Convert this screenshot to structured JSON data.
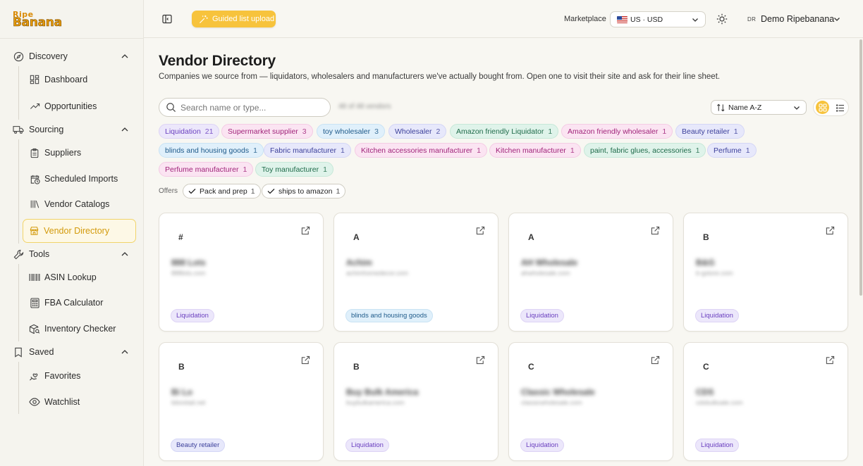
{
  "brand": {
    "logo_top": "Ripe",
    "logo_bottom": "Banana"
  },
  "sidebar": {
    "groups": [
      {
        "label": "Discovery",
        "items": [
          {
            "label": "Dashboard"
          },
          {
            "label": "Opportunities"
          }
        ]
      },
      {
        "label": "Sourcing",
        "items": [
          {
            "label": "Suppliers"
          },
          {
            "label": "Scheduled Imports"
          },
          {
            "label": "Vendor Catalogs"
          },
          {
            "label": "Vendor Directory",
            "active": true
          }
        ]
      },
      {
        "label": "Tools",
        "items": [
          {
            "label": "ASIN Lookup"
          },
          {
            "label": "FBA Calculator"
          },
          {
            "label": "Inventory Checker"
          }
        ]
      },
      {
        "label": "Saved",
        "items": [
          {
            "label": "Favorites"
          },
          {
            "label": "Watchlist"
          }
        ]
      }
    ]
  },
  "header": {
    "guided_label": "Guided list upload",
    "marketplace_label": "Marketplace",
    "marketplace_value": "US · USD",
    "user_initials": "DR",
    "user_name": "Demo Ripebanana"
  },
  "main": {
    "title": "Vendor Directory",
    "subtitle": "Companies we source from — liquidators, wholesalers and manufacturers we've actually bought from. Open one to visit their site and ask for their line sheet.",
    "search_placeholder": "Search name or type...",
    "count_text": "48 of 48 vendors",
    "sort_value": "Name A-Z",
    "chips": [
      {
        "label": "Liquidation",
        "count": "21",
        "color": "purple"
      },
      {
        "label": "Supermarket supplier",
        "count": "3",
        "color": "pink"
      },
      {
        "label": "toy wholesaler",
        "count": "3",
        "color": "blue"
      },
      {
        "label": "Wholesaler",
        "count": "2",
        "color": "indigo"
      },
      {
        "label": "Amazon friendly Liquidator",
        "count": "1",
        "color": "green"
      },
      {
        "label": "Amazon friendly wholesaler",
        "count": "1",
        "color": "pink"
      },
      {
        "label": "Beauty retailer",
        "count": "1",
        "color": "indigo"
      },
      {
        "label": "blinds and housing goods",
        "count": "1",
        "color": "blue"
      },
      {
        "label": "Fabric manufacturer",
        "count": "1",
        "color": "indigo"
      },
      {
        "label": "Kitchen accessories manufacturer",
        "count": "1",
        "color": "pink"
      },
      {
        "label": "Kitchen manufacturer",
        "count": "1",
        "color": "pink"
      },
      {
        "label": "paint, fabric glues, accessories",
        "count": "1",
        "color": "green"
      },
      {
        "label": "Perfume",
        "count": "1",
        "color": "indigo"
      },
      {
        "label": "Perfume manufacturer",
        "count": "1",
        "color": "pink"
      },
      {
        "label": "Toy manufacturer",
        "count": "1",
        "color": "green"
      }
    ],
    "offers_label": "Offers",
    "offers": [
      {
        "label": "Pack and prep",
        "count": "1"
      },
      {
        "label": "ships to amazon",
        "count": "1"
      }
    ],
    "cards": [
      {
        "letter": "#",
        "name": "888 Lots",
        "url": "888lots.com",
        "tag": "Liquidation",
        "tag_color": "purple"
      },
      {
        "letter": "A",
        "name": "Achim",
        "url": "achimhomedecor.com",
        "tag": "blinds and housing goods",
        "tag_color": "blue"
      },
      {
        "letter": "A",
        "name": "AH Wholesale",
        "url": "ahwholesale.com",
        "tag": "Liquidation",
        "tag_color": "purple"
      },
      {
        "letter": "B",
        "name": "B&G",
        "url": "b-gstore.com",
        "tag": "Liquidation",
        "tag_color": "purple"
      },
      {
        "letter": "B",
        "name": "Bi Lo",
        "url": "biloretail.net",
        "tag": "Beauty retailer",
        "tag_color": "indigo"
      },
      {
        "letter": "B",
        "name": "Buy Bulk America",
        "url": "buybulkamerica.com",
        "tag": "Liquidation",
        "tag_color": "purple"
      },
      {
        "letter": "C",
        "name": "Classic Wholesale",
        "url": "classicwholesale.com",
        "tag": "Liquidation",
        "tag_color": "purple"
      },
      {
        "letter": "C",
        "name": "CDS",
        "url": "cdsbulksale.com",
        "tag": "Liquidation",
        "tag_color": "purple"
      }
    ]
  }
}
